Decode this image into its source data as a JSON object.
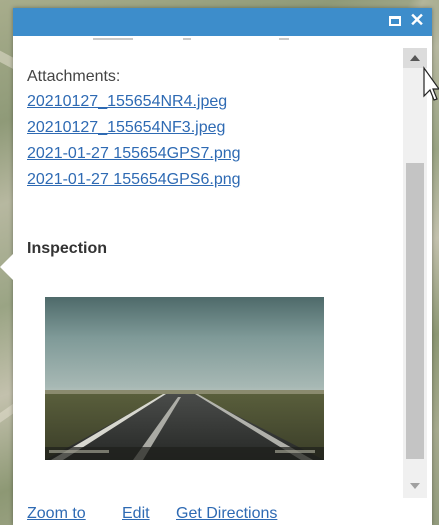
{
  "popup": {
    "attachments_label": "Attachments:",
    "attachments": [
      "20210127_155654NR4.jpeg",
      "20210127_155654NF3.jpeg",
      "2021-01-27 155654GPS7.png",
      "2021-01-27 155654GPS6.png"
    ],
    "section_title": "Inspection",
    "actions": {
      "zoom_to": "Zoom to",
      "edit": "Edit",
      "get_directions": "Get Directions"
    }
  },
  "colors": {
    "header": "#3d8dcb",
    "link": "#2e6ab3"
  },
  "icons": {
    "maximize": "maximize-icon",
    "close": "close-icon"
  }
}
